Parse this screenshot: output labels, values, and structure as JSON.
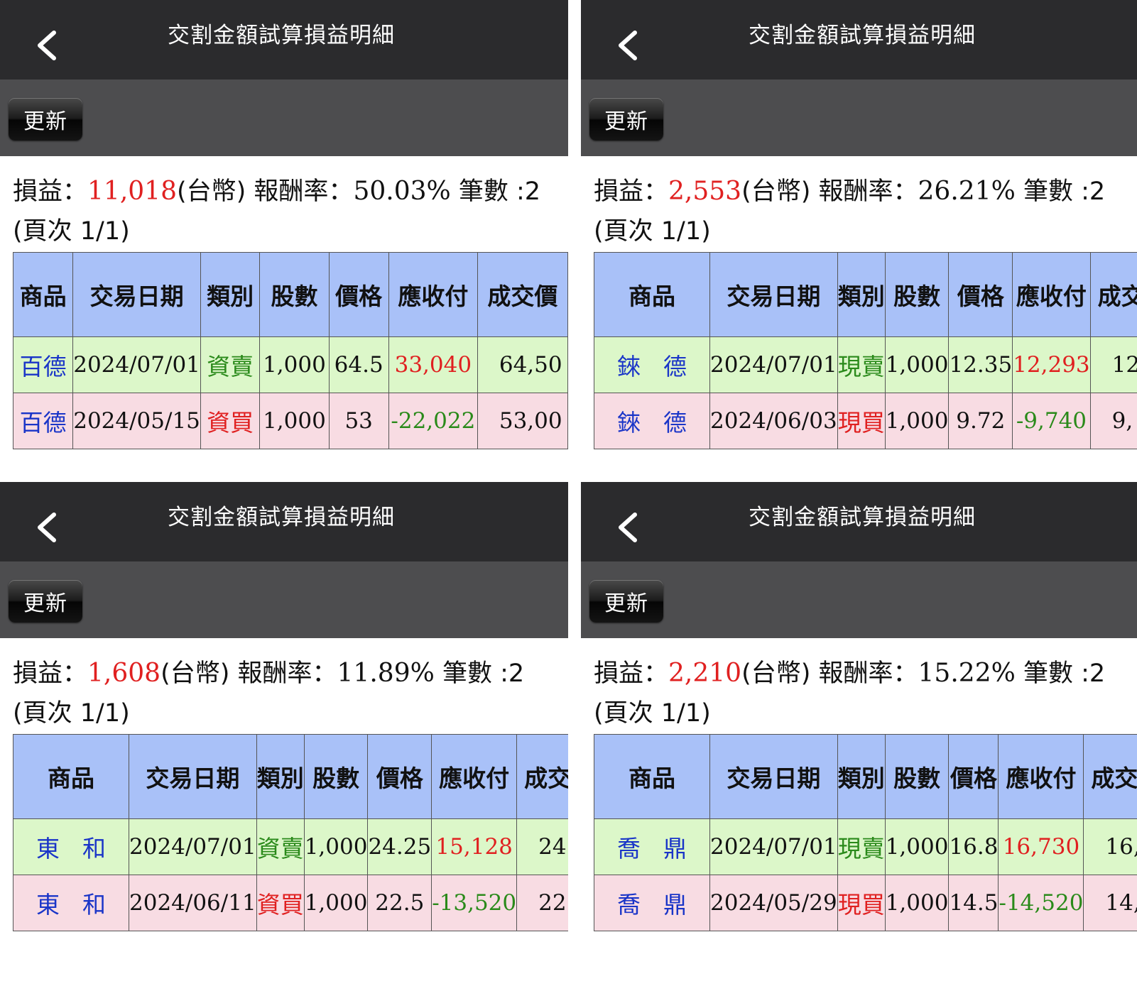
{
  "panels": [
    {
      "title": "交割金額試算損益明細",
      "refresh_label": "更新",
      "summary": {
        "pnl_label": "損益：",
        "pnl_value": "11,018",
        "currency": "(台幣)",
        "rate_label": " 報酬率：",
        "rate_value": "50.03%",
        "count_label": " 筆數 :2",
        "page_label": "(頁次 1/1)"
      },
      "headers": [
        "商品",
        "交易日期",
        "類別",
        "股數",
        "價格",
        "應收付",
        "成交價"
      ],
      "rows": [
        {
          "product": "百德",
          "date": "2024/07/01",
          "type": "資賣",
          "shares": "1,000",
          "price": "64.5",
          "amount": "33,040",
          "total": "64,50"
        },
        {
          "product": "百德",
          "date": "2024/05/15",
          "type": "資買",
          "shares": "1,000",
          "price": "53",
          "amount": "-22,022",
          "total": "53,00"
        }
      ]
    },
    {
      "title": "交割金額試算損益明細",
      "refresh_label": "更新",
      "summary": {
        "pnl_label": "損益：",
        "pnl_value": "2,553",
        "currency": "(台幣)",
        "rate_label": " 報酬率：",
        "rate_value": "26.21%",
        "count_label": " 筆數 :2",
        "page_label": "(頁次 1/1)"
      },
      "headers": [
        "商品",
        "交易日期",
        "類別",
        "股數",
        "價格",
        "應收付",
        "成交"
      ],
      "rows": [
        {
          "product": "錸德",
          "date": "2024/07/01",
          "type": "現賣",
          "shares": "1,000",
          "price": "12.35",
          "amount": "12,293",
          "total": "12"
        },
        {
          "product": "錸德",
          "date": "2024/06/03",
          "type": "現買",
          "shares": "1,000",
          "price": "9.72",
          "amount": "-9,740",
          "total": "9,"
        }
      ]
    },
    {
      "title": "交割金額試算損益明細",
      "refresh_label": "更新",
      "summary": {
        "pnl_label": "損益：",
        "pnl_value": "1,608",
        "currency": "(台幣)",
        "rate_label": " 報酬率：",
        "rate_value": "11.89%",
        "count_label": " 筆數 :2",
        "page_label": "(頁次 1/1)"
      },
      "headers": [
        "商品",
        "交易日期",
        "類別",
        "股數",
        "價格",
        "應收付",
        "成交"
      ],
      "rows": [
        {
          "product": "東和",
          "date": "2024/07/01",
          "type": "資賣",
          "shares": "1,000",
          "price": "24.25",
          "amount": "15,128",
          "total": "24"
        },
        {
          "product": "東和",
          "date": "2024/06/11",
          "type": "資買",
          "shares": "1,000",
          "price": "22.5",
          "amount": "-13,520",
          "total": "22"
        }
      ]
    },
    {
      "title": "交割金額試算損益明細",
      "refresh_label": "更新",
      "summary": {
        "pnl_label": "損益：",
        "pnl_value": "2,210",
        "currency": "(台幣)",
        "rate_label": " 報酬率：",
        "rate_value": "15.22%",
        "count_label": " 筆數 :2",
        "page_label": "(頁次 1/1)"
      },
      "headers": [
        "商品",
        "交易日期",
        "類別",
        "股數",
        "價格",
        "應收付",
        "成交"
      ],
      "rows": [
        {
          "product": "喬鼎",
          "date": "2024/07/01",
          "type": "現賣",
          "shares": "1,000",
          "price": "16.8",
          "amount": "16,730",
          "total": "16,"
        },
        {
          "product": "喬鼎",
          "date": "2024/05/29",
          "type": "現買",
          "shares": "1,000",
          "price": "14.5",
          "amount": "-14,520",
          "total": "14,"
        }
      ]
    }
  ],
  "icons": {
    "back": "chevron-left-icon"
  },
  "colors": {
    "navbar": "#2b2b2d",
    "toolbar": "#4d4d4f",
    "header_bg": "#a9c1f8",
    "sell_row": "#dcf7c9",
    "buy_row": "#f8dce3",
    "profit": "#e02020",
    "loss": "#2a8a1a",
    "product": "#1a35c8"
  }
}
